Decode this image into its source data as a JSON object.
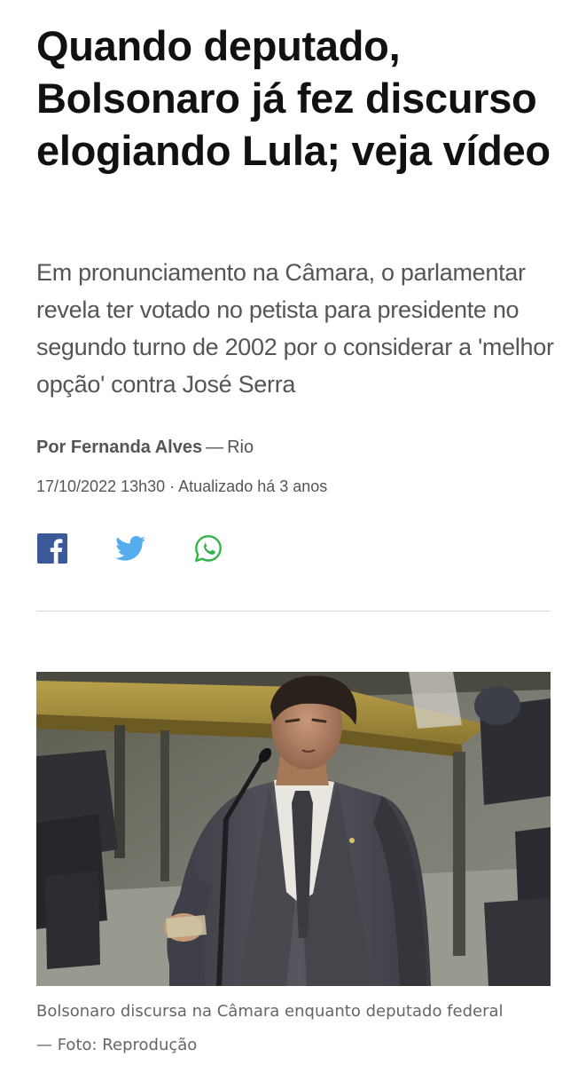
{
  "article": {
    "headline": "Quando deputado, Bolsonaro já fez discurso elogiando Lula; veja vídeo",
    "subheadline": "Em pronunciamento na Câmara, o parlamentar revela ter votado no petista para presidente no segundo turno de 2002 por o considerar a 'melhor opção' contra José Serra",
    "byline": {
      "author": "Por Fernanda Alves",
      "separator": "—",
      "location": "Rio"
    },
    "dateline": "17/10/2022 13h30 · Atualizado há 3 anos"
  },
  "share": {
    "buttons": [
      {
        "icon": "facebook-icon",
        "color": "#3b5998"
      },
      {
        "icon": "twitter-icon",
        "color": "#55acee"
      },
      {
        "icon": "whatsapp-icon",
        "color": "#2fb54a"
      }
    ]
  },
  "media": {
    "caption": "Bolsonaro discursa na Câmara enquanto deputado federal — Foto: Reprodução"
  }
}
